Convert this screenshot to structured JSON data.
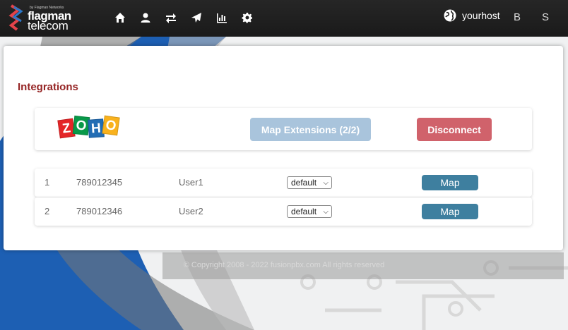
{
  "logo": {
    "tagline": "by Flagman Networks",
    "word1": "flagman",
    "word2": "telecom"
  },
  "nav": {
    "icons": [
      "home-icon",
      "user-icon",
      "exchange-icon",
      "paper-plane-icon",
      "bar-chart-icon",
      "gear-icon"
    ],
    "host_label": "yourhost",
    "button_b": "B",
    "button_s": "S"
  },
  "page": {
    "title": "Integrations"
  },
  "integration": {
    "logo_letters": [
      "Z",
      "O",
      "H",
      "O"
    ],
    "map_extensions_label": "Map Extensions (2/2)",
    "disconnect_label": "Disconnect"
  },
  "rows": [
    {
      "num": "1",
      "extension": "789012345",
      "user": "User1",
      "select_value": "default",
      "map_label": "Map"
    },
    {
      "num": "2",
      "extension": "789012346",
      "user": "User2",
      "select_value": "default",
      "map_label": "Map"
    }
  ],
  "footer": {
    "text": "© Copyright 2008 - 2022 fusionpbx.com All rights reserved"
  },
  "colors": {
    "title": "#952424",
    "map_extensions": "#a9c4dc",
    "disconnect": "#d0626b",
    "map": "#3e7f9f",
    "navbar": "#1f1f1f"
  }
}
